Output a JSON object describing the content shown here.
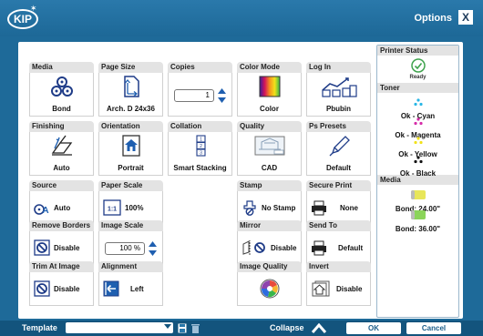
{
  "titlebar": {
    "logo": "KIP",
    "options_label": "Options",
    "close_label": "X"
  },
  "tiles": {
    "media": {
      "header": "Media",
      "label": "Bond"
    },
    "page_size": {
      "header": "Page Size",
      "label": "Arch. D 24x36"
    },
    "copies": {
      "header": "Copies",
      "value": "1"
    },
    "color_mode": {
      "header": "Color Mode",
      "label": "Color"
    },
    "log_in": {
      "header": "Log In",
      "label": "Pbubin"
    },
    "finishing": {
      "header": "Finishing",
      "label": "Auto"
    },
    "orientation": {
      "header": "Orientation",
      "label": "Portrait"
    },
    "collation": {
      "header": "Collation",
      "label": "Smart Stacking"
    },
    "quality": {
      "header": "Quality",
      "label": "CAD"
    },
    "ps_presets": {
      "header": "Ps Presets",
      "label": "Default"
    },
    "source": {
      "header": "Source",
      "label": "Auto"
    },
    "paper_scale": {
      "header": "Paper Scale",
      "icon_text": "1:1",
      "label": "100%"
    },
    "stamp": {
      "header": "Stamp",
      "label": "No Stamp"
    },
    "secure_print": {
      "header": "Secure Print",
      "label": "None"
    },
    "remove_borders": {
      "header": "Remove Borders",
      "label": "Disable"
    },
    "image_scale": {
      "header": "Image Scale",
      "value": "100 %"
    },
    "mirror": {
      "header": "Mirror",
      "label": "Disable"
    },
    "send_to": {
      "header": "Send To",
      "label": "Default"
    },
    "trim_at_image": {
      "header": "Trim At Image",
      "label": "Disable"
    },
    "alignment": {
      "header": "Alignment",
      "label": "Left"
    },
    "image_quality": {
      "header": "Image Quality"
    },
    "invert": {
      "header": "Invert",
      "label": "Disable"
    }
  },
  "status_panel": {
    "printer_status_header": "Printer Status",
    "printer_status": "Ready",
    "toner_header": "Toner",
    "toner": [
      {
        "label": "Ok - Cyan",
        "color": "#29b6e6"
      },
      {
        "label": "Ok - Magenta",
        "color": "#d62ca8"
      },
      {
        "label": "Ok - Yellow",
        "color": "#f2e21a"
      },
      {
        "label": "Ok - Black",
        "color": "#111111"
      }
    ],
    "media_header": "Media",
    "media": [
      {
        "label": "Bond: 24.00\"",
        "color": "#e8e65a"
      },
      {
        "label": "Bond: 36.00\"",
        "color": "#8bd45a"
      }
    ]
  },
  "footer": {
    "template_label": "Template",
    "collapse_label": "Collapse",
    "ok_label": "OK",
    "cancel_label": "Cancel"
  },
  "colors": {
    "accent": "#1e6a99",
    "footer": "#13547d",
    "link_blue": "#1f5fb0"
  }
}
